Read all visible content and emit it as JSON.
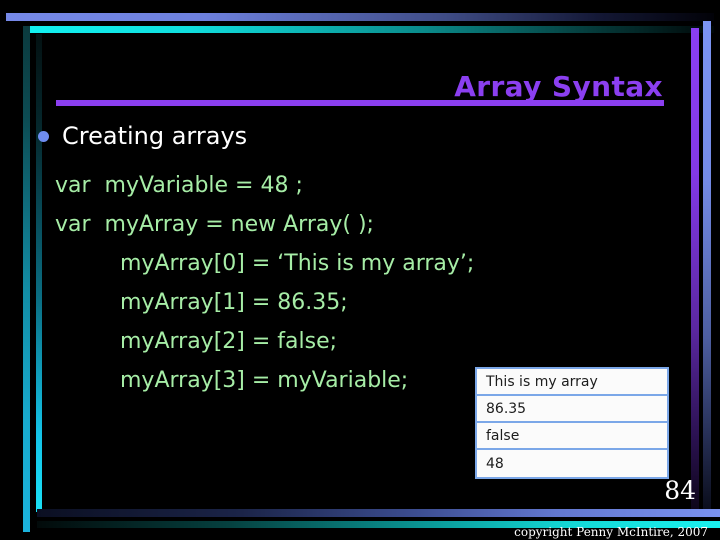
{
  "slide": {
    "title": "Array Syntax",
    "page_number": "84",
    "copyright": "copyright Penny McIntire, 2007",
    "background_color": "#000000"
  },
  "colors": {
    "title_purple": "#8b3ff0",
    "code_green": "#a6eda6",
    "bullet_blue": "#6f8df0",
    "border_cyan": "#1ae0f6",
    "border_blue": "#7c95f4",
    "table_border": "#7ba7e8",
    "body_white": "#ffffff"
  },
  "body": {
    "bullet": {
      "marker": "bullet-dot",
      "label": "Creating arrays"
    },
    "code_lines": [
      {
        "text": "var  myVariable = 48 ;",
        "indented": false
      },
      {
        "text": "var  myArray = new Array( );",
        "indented": false
      },
      {
        "text": "myArray[0] = ‘This is my array’;",
        "indented": true
      },
      {
        "text": "myArray[1] = 86.35;",
        "indented": true
      },
      {
        "text": "myArray[2] = false;",
        "indented": true
      },
      {
        "text": "myArray[3] = myVariable;",
        "indented": true
      }
    ]
  },
  "result_table": {
    "rows": [
      "This is my array",
      "86.35",
      "false",
      "48"
    ]
  }
}
